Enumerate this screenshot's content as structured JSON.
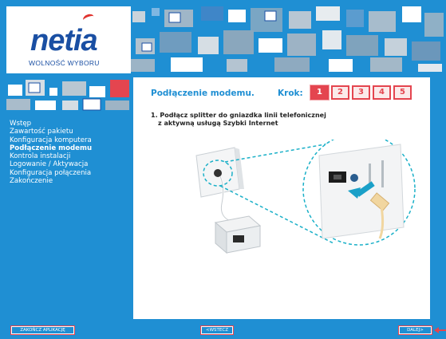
{
  "brand": {
    "logo_text": "netia",
    "slogan": "WOLNOŚĆ WYBORU"
  },
  "sidebar": {
    "items": [
      {
        "label": "Wstęp",
        "active": false
      },
      {
        "label": "Zawartość pakietu",
        "active": false
      },
      {
        "label": "Konfiguracja komputera",
        "active": false
      },
      {
        "label": "Podłączenie modemu",
        "active": true
      },
      {
        "label": "Kontrola instalacji",
        "active": false
      },
      {
        "label": "Logowanie / Aktywacja",
        "active": false
      },
      {
        "label": "Konfiguracja połączenia",
        "active": false
      },
      {
        "label": "Zakończenie",
        "active": false
      }
    ]
  },
  "main": {
    "title": "Podłączenie modemu.",
    "step_label": "Krok:",
    "steps": [
      "1",
      "2",
      "3",
      "4",
      "5"
    ],
    "current_step": "1",
    "instruction_line1": "1. Podłącz splitter do gniazdka linii telefonicznej",
    "instruction_line2": "z aktywną usługą Szybki Internet"
  },
  "buttons": {
    "exit_label": "ZAKOŃCZ APLIKACJĘ",
    "back_label": "<WSTECZ",
    "next_label": "DALEJ>"
  },
  "colors": {
    "background": "#1f8fd3",
    "accent_red": "#e4454f",
    "logo_blue": "#1a4fa3"
  }
}
